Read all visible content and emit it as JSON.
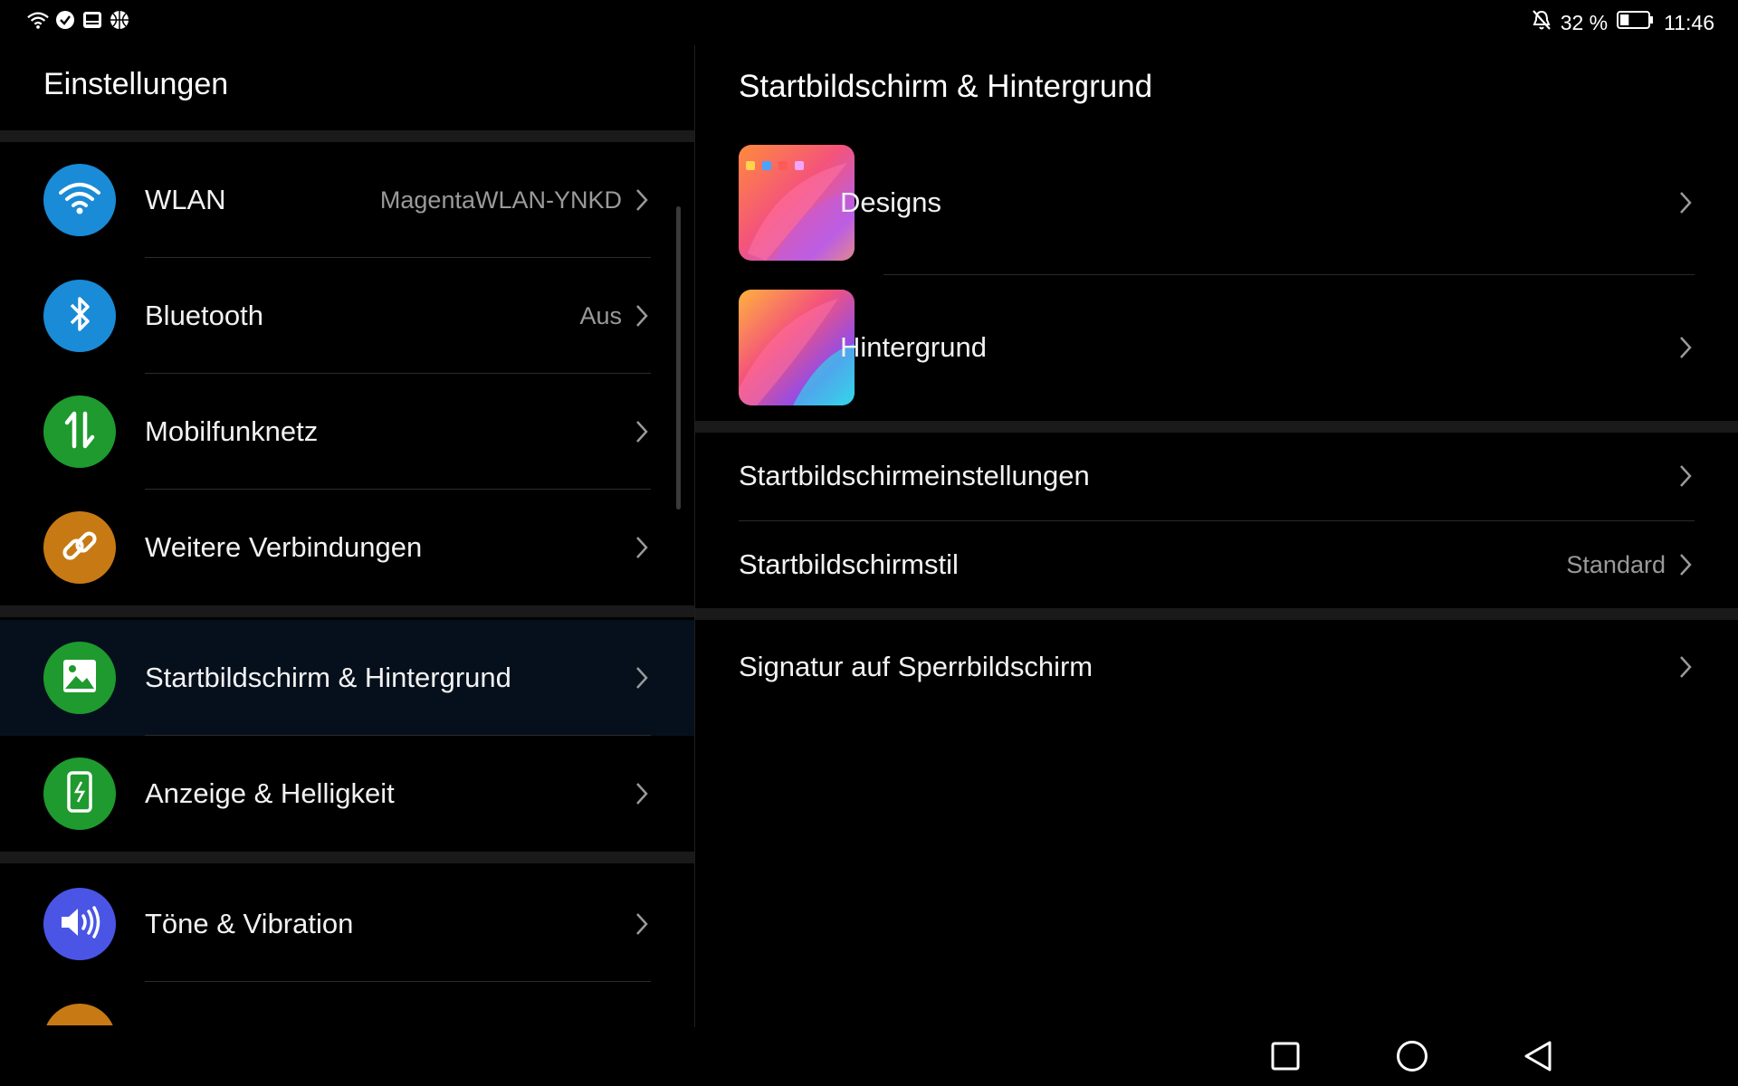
{
  "statusbar": {
    "battery_percent": "32 %",
    "battery_level": 0.32,
    "time": "11:46",
    "icons": [
      "wifi-icon",
      "check-circle-icon",
      "notification-badge-icon",
      "basketball-icon",
      "mute-bell-icon",
      "battery-icon"
    ]
  },
  "left": {
    "title": "Einstellungen",
    "items": [
      {
        "label": "WLAN",
        "value": "MagentaWLAN-YNKD",
        "icon": "wifi-icon",
        "color": "#1a8bd6"
      },
      {
        "label": "Bluetooth",
        "value": "Aus",
        "icon": "bluetooth-icon",
        "color": "#1a8bd6"
      },
      {
        "label": "Mobilfunknetz",
        "value": "",
        "icon": "mobile-data-icon",
        "color": "#1f9a2e"
      },
      {
        "label": "Weitere Verbindungen",
        "value": "",
        "icon": "link-icon",
        "color": "#c77a14"
      },
      {
        "label": "Startbildschirm & Hintergrund",
        "value": "",
        "icon": "image-icon",
        "color": "#1f9a2e"
      },
      {
        "label": "Anzeige & Helligkeit",
        "value": "",
        "icon": "phone-brightness-icon",
        "color": "#1f9a2e"
      },
      {
        "label": "Töne & Vibration",
        "value": "",
        "icon": "speaker-icon",
        "color": "#4a55e6"
      }
    ],
    "selected_index": 4
  },
  "right": {
    "title": "Startbildschirm & Hintergrund",
    "items": [
      {
        "label": "Designs",
        "value": "",
        "thumb": "designs-thumbnail"
      },
      {
        "label": "Hintergrund",
        "value": "",
        "thumb": "wallpaper-thumbnail"
      },
      {
        "label": "Startbildschirmeinstellungen",
        "value": ""
      },
      {
        "label": "Startbildschirmstil",
        "value": "Standard"
      },
      {
        "label": "Signatur auf Sperrbildschirm",
        "value": ""
      }
    ]
  },
  "navbar": {
    "buttons": [
      "recent-apps-button",
      "home-button",
      "back-button"
    ]
  }
}
